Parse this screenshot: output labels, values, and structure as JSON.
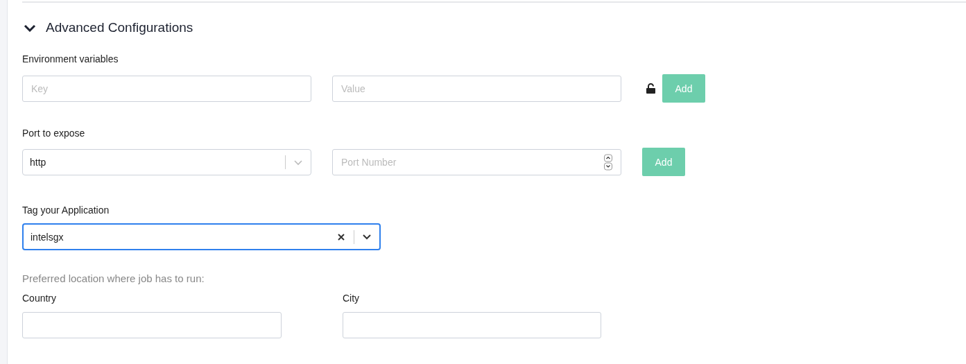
{
  "section": {
    "title": "Advanced Configurations",
    "expanded": true
  },
  "env": {
    "label": "Environment variables",
    "key_placeholder": "Key",
    "value_placeholder": "Value",
    "locked": false,
    "button": "Add"
  },
  "port": {
    "label": "Port to expose",
    "protocol": "http",
    "number_placeholder": "Port Number",
    "button": "Add"
  },
  "tag": {
    "label": "Tag your Application",
    "value": "intelsgx",
    "focused": true
  },
  "location": {
    "heading": "Preferred location where job has to run:",
    "fields": [
      {
        "label": "Country"
      },
      {
        "label": "City"
      }
    ]
  }
}
